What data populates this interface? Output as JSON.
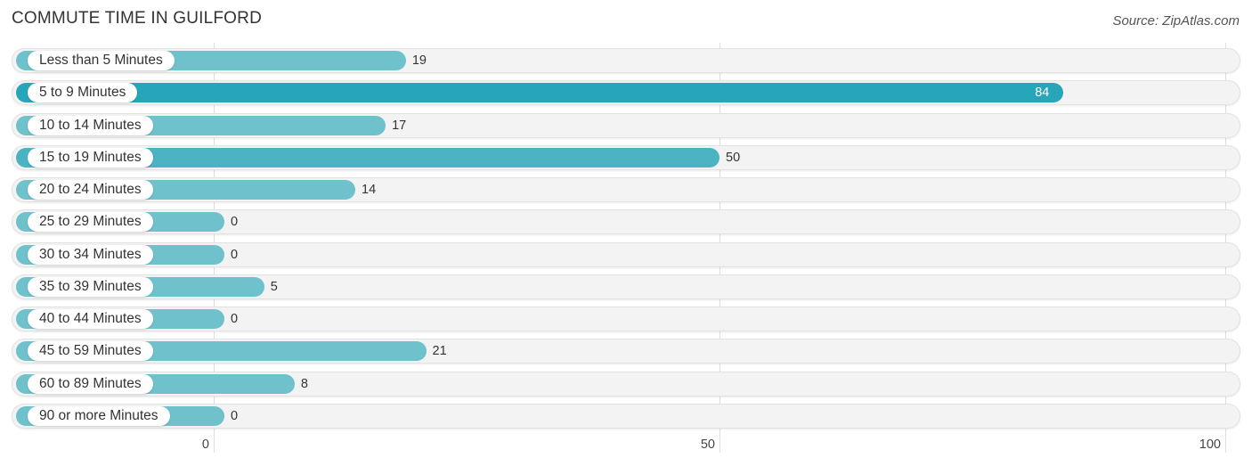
{
  "header": {
    "title": "COMMUTE TIME IN GUILFORD",
    "source": "Source: ZipAtlas.com"
  },
  "colors": {
    "bar": "#6fc2cc",
    "bar_highlight": "#26a6b8",
    "bar_mid": "#4bb3c2"
  },
  "chart_data": {
    "type": "bar",
    "orientation": "horizontal",
    "title": "COMMUTE TIME IN GUILFORD",
    "categories": [
      "Less than 5 Minutes",
      "5 to 9 Minutes",
      "10 to 14 Minutes",
      "15 to 19 Minutes",
      "20 to 24 Minutes",
      "25 to 29 Minutes",
      "30 to 34 Minutes",
      "35 to 39 Minutes",
      "40 to 44 Minutes",
      "45 to 59 Minutes",
      "60 to 89 Minutes",
      "90 or more Minutes"
    ],
    "values": [
      19,
      84,
      17,
      50,
      14,
      0,
      0,
      5,
      0,
      21,
      8,
      0
    ],
    "xlim": [
      0,
      100
    ],
    "xticks": [
      "0",
      "50",
      "100"
    ],
    "xlabel": "",
    "ylabel": "",
    "grid": true
  }
}
